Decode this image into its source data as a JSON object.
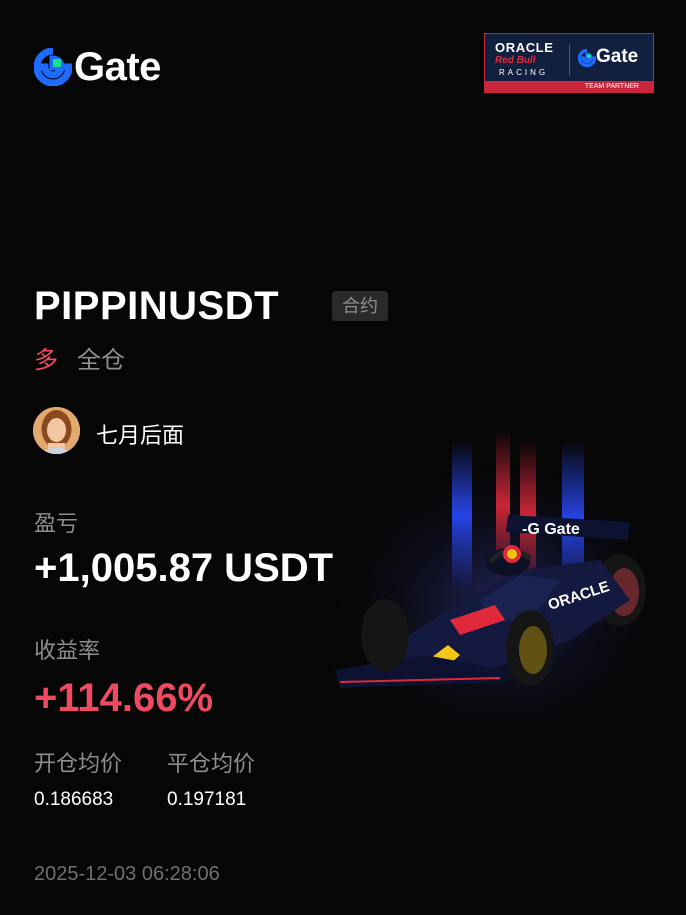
{
  "brand": {
    "logo_text": "Gate"
  },
  "partner_badge": {
    "oracle": "ORACLE",
    "red_bull": "Red Bull",
    "racing": "RACING",
    "gate": "Gate",
    "team_partner": "TEAM PARTNER"
  },
  "position": {
    "pair": "PIPPINUSDT",
    "contract_type": "合约",
    "direction": "多",
    "margin_mode": "全仓"
  },
  "user": {
    "name": "七月后面"
  },
  "pnl": {
    "label": "盈亏",
    "value": "+1,005.87 USDT"
  },
  "roi": {
    "label": "收益率",
    "value": "+114.66%"
  },
  "prices": {
    "open_label": "开仓均价",
    "close_label": "平仓均价",
    "open_value": "0.186683",
    "close_value": "0.197181"
  },
  "timestamp": "2025-12-03 06:28:06",
  "colors": {
    "background": "#060606",
    "profit_red": "#ef4a5f",
    "muted": "#8e8e8e",
    "brand_blue": "#1f6bff",
    "brand_green": "#17e18e"
  },
  "icons": {
    "logo": "gate-logo-icon",
    "car": "f1-car-illustration",
    "avatar": "user-avatar"
  }
}
